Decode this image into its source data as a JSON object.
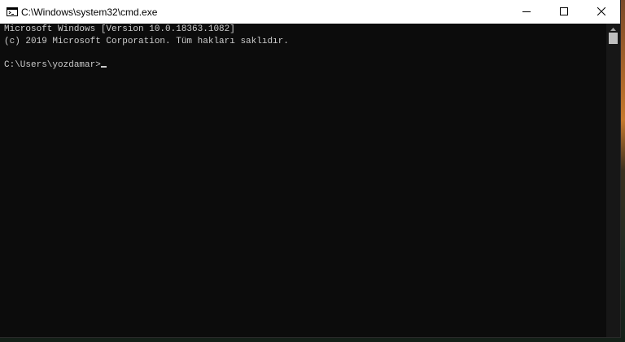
{
  "window": {
    "title": "C:\\Windows\\system32\\cmd.exe",
    "icon": "cmd-icon"
  },
  "controls": {
    "minimize_icon": "minimize-icon",
    "maximize_icon": "maximize-icon",
    "close_icon": "close-icon"
  },
  "console": {
    "lines": [
      "Microsoft Windows [Version 10.0.18363.1082]",
      "(c) 2019 Microsoft Corporation. Tüm hakları saklıdır.",
      ""
    ],
    "prompt": "C:\\Users\\yozdamar>",
    "colors": {
      "background": "#0c0c0c",
      "foreground": "#cccccc"
    }
  }
}
